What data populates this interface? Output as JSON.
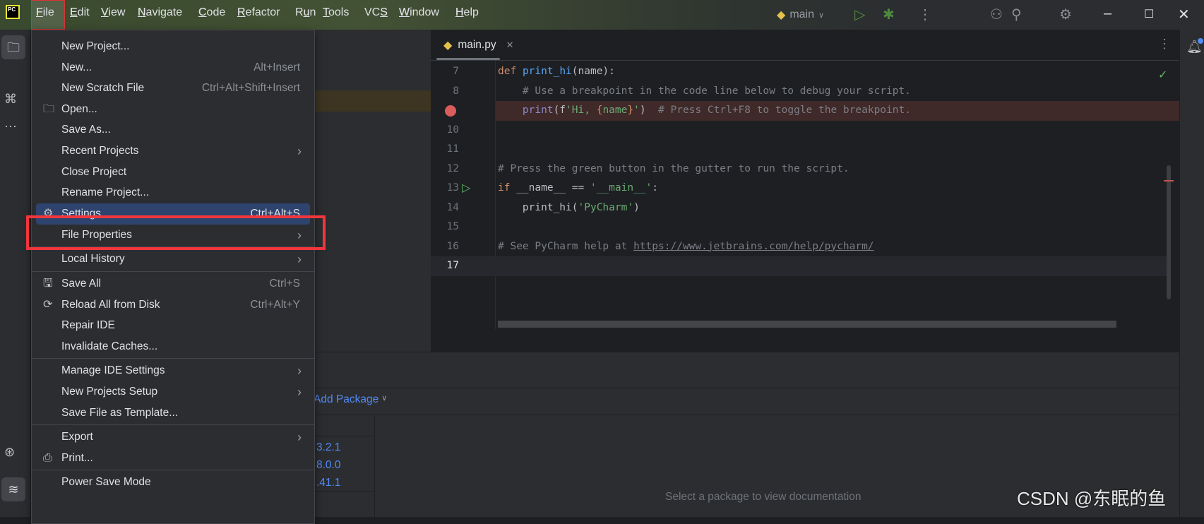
{
  "menubar": {
    "items": [
      {
        "label": "File",
        "mn": "F"
      },
      {
        "label": "Edit",
        "mn": "E"
      },
      {
        "label": "View",
        "mn": "V"
      },
      {
        "label": "Navigate",
        "mn": "N"
      },
      {
        "label": "Code",
        "mn": "C"
      },
      {
        "label": "Refactor",
        "mn": "R"
      },
      {
        "label": "Run",
        "mn": "u"
      },
      {
        "label": "Tools",
        "mn": "T"
      },
      {
        "label": "VCS",
        "mn": "S"
      },
      {
        "label": "Window",
        "mn": "W"
      },
      {
        "label": "Help",
        "mn": "H"
      }
    ]
  },
  "toolbar": {
    "run_config": "main",
    "icons": [
      "python-icon",
      "run-icon",
      "debug-icon",
      "more-icon",
      "add-user-icon",
      "search-icon",
      "gear-icon",
      "minimize-icon",
      "maximize-icon",
      "close-icon"
    ]
  },
  "logo": "PC",
  "editor": {
    "tab": "main.py",
    "lines": [
      {
        "n": "7",
        "html": "def print_hi(name):"
      },
      {
        "n": "8",
        "text": "    # Use a breakpoint in the code line below to debug your script."
      },
      {
        "n": "9",
        "text": "    print(f'Hi, {name}')  # Press Ctrl+F8 to toggle the breakpoint.",
        "breakpoint": true
      },
      {
        "n": "10",
        "text": ""
      },
      {
        "n": "11",
        "text": ""
      },
      {
        "n": "12",
        "text": "# Press the green button in the gutter to run the script."
      },
      {
        "n": "13",
        "text": "if __name__ == '__main__':",
        "run": true
      },
      {
        "n": "14",
        "text": "    print_hi('PyCharm')"
      },
      {
        "n": "15",
        "text": ""
      },
      {
        "n": "16",
        "text": "# See PyCharm help at https://www.jetbrains.com/help/pycharm/"
      },
      {
        "n": "17",
        "text": "",
        "current": true
      }
    ]
  },
  "file_menu": {
    "items": [
      {
        "label": "New Project..."
      },
      {
        "label": "New...",
        "shortcut": "Alt+Insert"
      },
      {
        "label": "New Scratch File",
        "shortcut": "Ctrl+Alt+Shift+Insert"
      },
      {
        "label": "Open...",
        "icon": "folder-icon"
      },
      {
        "label": "Save As..."
      },
      {
        "label": "Recent Projects",
        "submenu": true
      },
      {
        "label": "Close Project"
      },
      {
        "label": "Rename Project..."
      },
      {
        "label": "Settings...",
        "shortcut": "Ctrl+Alt+S",
        "icon": "gear-icon",
        "selected": true
      },
      {
        "label": "File Properties",
        "submenu": true
      },
      {
        "label": "Local History",
        "submenu": true
      },
      {
        "label": "Save All",
        "shortcut": "Ctrl+S",
        "icon": "save-icon"
      },
      {
        "label": "Reload All from Disk",
        "shortcut": "Ctrl+Alt+Y",
        "icon": "reload-icon"
      },
      {
        "label": "Repair IDE"
      },
      {
        "label": "Invalidate Caches..."
      },
      {
        "label": "Manage IDE Settings",
        "submenu": true
      },
      {
        "label": "New Projects Setup",
        "submenu": true
      },
      {
        "label": "Save File as Template..."
      },
      {
        "label": "Export",
        "submenu": true
      },
      {
        "label": "Print...",
        "icon": "print-icon"
      },
      {
        "label": "Power Save Mode"
      }
    ]
  },
  "packages": {
    "add_package": "Add Package",
    "versions": [
      "3.2.1",
      "8.0.0",
      ".41.1"
    ],
    "doc_placeholder": "Select a package to view documentation"
  },
  "watermark": "CSDN @东眠的鱼",
  "colors": {
    "selection": "#2e436e",
    "accent_link": "#548af7",
    "breakpoint": "#db5c5c",
    "annotation_box": "#f0363c"
  }
}
